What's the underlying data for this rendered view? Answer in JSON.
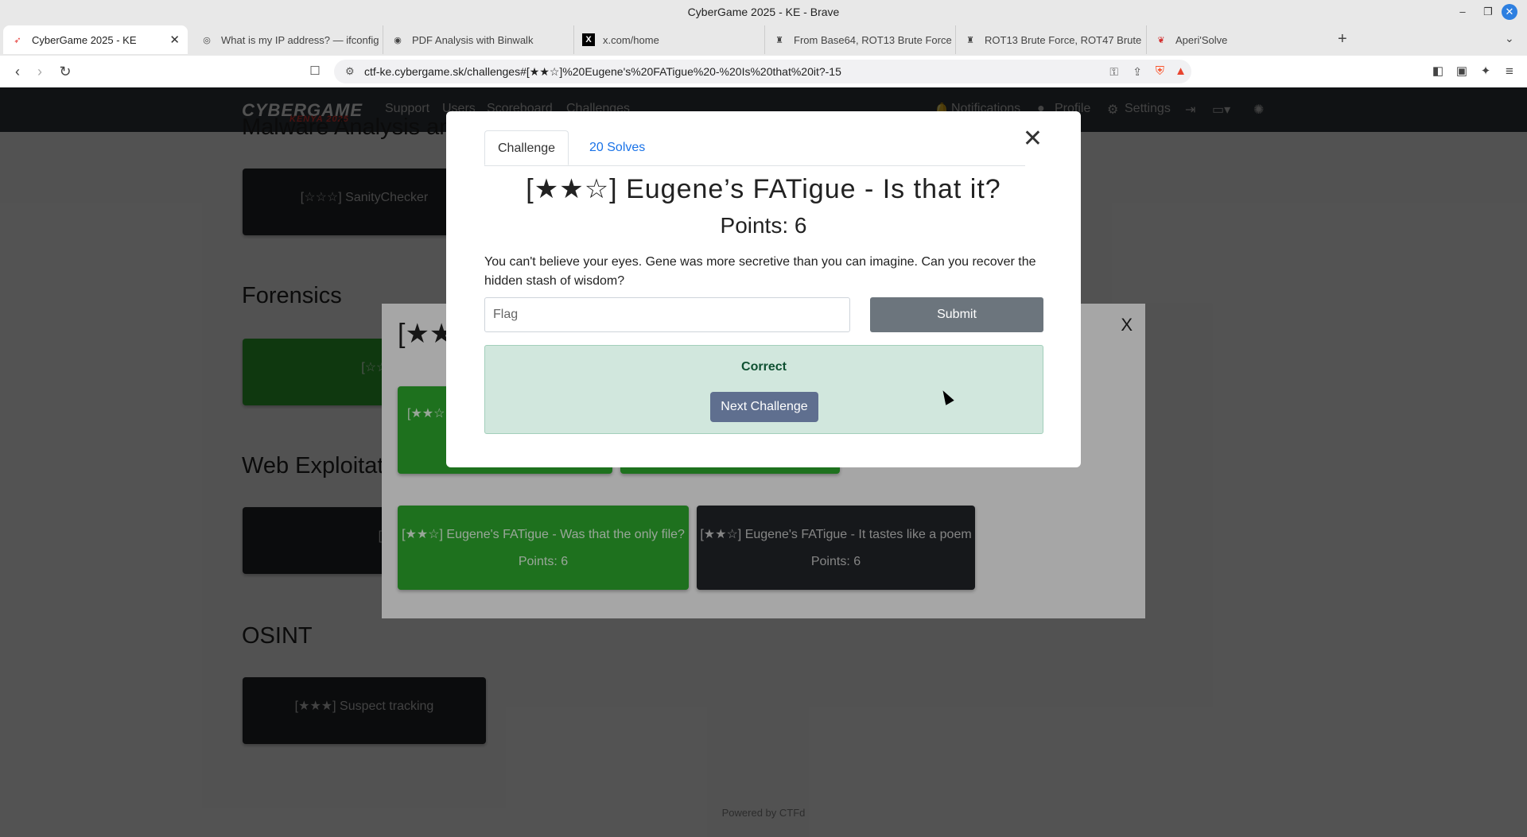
{
  "window": {
    "title": "CyberGame 2025 - KE - Brave"
  },
  "tabs": [
    {
      "label": "CyberGame 2025 - KE",
      "active": true,
      "icon": "cybergame-favicon"
    },
    {
      "label": "What is my IP address? — ifconfig",
      "icon": "ifconfig-favicon"
    },
    {
      "label": "PDF Analysis with Binwalk",
      "icon": "binwalk-favicon"
    },
    {
      "label": "x.com/home",
      "icon": "x-favicon"
    },
    {
      "label": "From Base64, ROT13 Brute Force",
      "icon": "cyberchef-favicon"
    },
    {
      "label": "ROT13 Brute Force, ROT47 Brute",
      "icon": "cyberchef-favicon"
    },
    {
      "label": "Aperi'Solve",
      "icon": "aperisolve-favicon"
    }
  ],
  "address": {
    "url": "ctf-ke.cybergame.sk/challenges#[★★☆]%20Eugene's%20FATigue%20-%20Is%20that%20it?-15"
  },
  "site": {
    "logo_main": "CYBERGAME",
    "logo_sub": "KENYA 2025",
    "nav_left": [
      "Support",
      "Users",
      "Scoreboard",
      "Challenges"
    ],
    "nav_right": [
      "Notifications",
      "Profile",
      "Settings"
    ],
    "categories": {
      "malware": "Malware Analysis and",
      "forensics": "Forensics",
      "web": "Web Exploitat",
      "osint": "OSINT"
    },
    "cards": {
      "sanity": "[☆☆☆] SanityChecker",
      "first": "[☆☆☆] First",
      "equ": "[★★☆] Equ",
      "suspect": "[★★★] Suspect tracking"
    },
    "footer": "Powered by CTFd"
  },
  "group_modal": {
    "title_partial": "[★★",
    "close": "X",
    "card_partial": "[★★☆",
    "cards": [
      {
        "name": "[★★☆] Eugene's FATigue - Was that the only file?",
        "points": "Points: 6",
        "solved": true
      },
      {
        "name": "[★★☆] Eugene's FATigue - It tastes like a poem",
        "points": "Points: 6",
        "solved": false
      }
    ]
  },
  "challenge_modal": {
    "tab_challenge": "Challenge",
    "tab_solves": "20 Solves",
    "title": "[★★☆] Eugene’s FATigue - Is that it?",
    "points": "Points: 6",
    "description": "You can't believe your eyes. Gene was more secretive than you can imagine. Can you recover the hidden stash of wisdom?",
    "flag_placeholder": "Flag",
    "submit_label": "Submit",
    "result_text": "Correct",
    "next_label": "Next Challenge"
  },
  "colors": {
    "nav": "#343a40",
    "solved": "#2fae2f",
    "unsolved": "#22262a",
    "success_bg": "#d1e7dd"
  }
}
